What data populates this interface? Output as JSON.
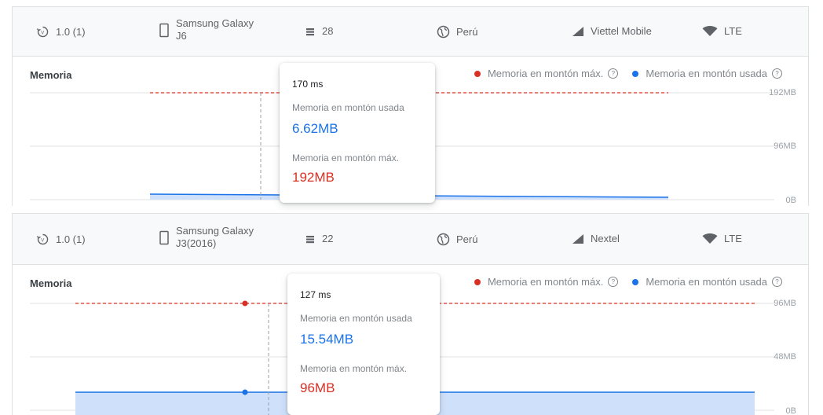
{
  "panels": [
    {
      "version": "1.0 (1)",
      "device_line1": "Samsung Galaxy",
      "device_line2": "J6",
      "api_level": "28",
      "country": "Perú",
      "carrier": "Viettel Mobile",
      "network": "LTE",
      "chart_title": "Memoria",
      "legend_max": "Memoria en montón máx.",
      "legend_used": "Memoria en montón usada",
      "help_glyph": "?",
      "ticks": [
        "192MB",
        "96MB",
        "0B"
      ],
      "tooltip": {
        "time": "170 ms",
        "used_label": "Memoria en montón usada",
        "used_value": "6.62MB",
        "max_label": "Memoria en montón máx.",
        "max_value": "192MB"
      }
    },
    {
      "version": "1.0 (1)",
      "device_line1": "Samsung Galaxy",
      "device_line2": "J3(2016)",
      "api_level": "22",
      "country": "Perú",
      "carrier": "Nextel",
      "network": "LTE",
      "chart_title": "Memoria",
      "legend_max": "Memoria en montón máx.",
      "legend_used": "Memoria en montón usada",
      "help_glyph": "?",
      "ticks": [
        "96MB",
        "48MB",
        "0B"
      ],
      "tooltip": {
        "time": "127 ms",
        "used_label": "Memoria en montón usada",
        "used_value": "15.54MB",
        "max_label": "Memoria en montón máx.",
        "max_value": "96MB"
      }
    }
  ],
  "colors": {
    "max": "#d93025",
    "used": "#1a73e8",
    "used_fill": "#cfe0fa"
  },
  "icons": [
    "version-icon",
    "phone-icon",
    "api-level-icon",
    "globe-icon",
    "signal-icon",
    "wifi-icon",
    "help-icon"
  ]
}
